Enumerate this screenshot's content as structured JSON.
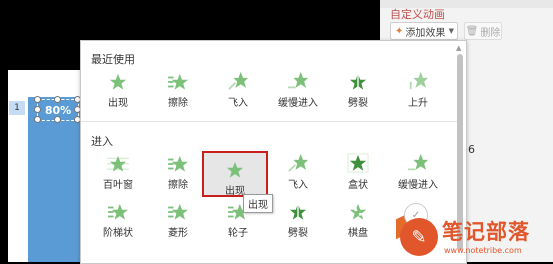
{
  "pane": {
    "title": "自定义动画",
    "add_label": "添加效果",
    "delete_label": "删除",
    "list_number": "6"
  },
  "slide": {
    "number": "1",
    "percent": "80%"
  },
  "popup": {
    "recent_title": "最近使用",
    "enter_title": "进入",
    "recent": [
      {
        "label": "出现",
        "icon": "star-appear-icon"
      },
      {
        "label": "擦除",
        "icon": "star-wipe-icon"
      },
      {
        "label": "飞入",
        "icon": "star-fly-in-icon"
      },
      {
        "label": "缓慢进入",
        "icon": "star-crawl-in-icon"
      },
      {
        "label": "劈裂",
        "icon": "star-split-icon"
      },
      {
        "label": "上升",
        "icon": "star-ascend-icon"
      }
    ],
    "enter_row1": [
      {
        "label": "百叶窗",
        "icon": "star-blinds-icon"
      },
      {
        "label": "擦除",
        "icon": "star-wipe-icon"
      },
      {
        "label": "出现",
        "icon": "star-appear-icon"
      },
      {
        "label": "飞入",
        "icon": "star-fly-in-icon"
      },
      {
        "label": "盒状",
        "icon": "star-box-icon"
      },
      {
        "label": "缓慢进入",
        "icon": "star-crawl-in-icon"
      }
    ],
    "enter_row2": [
      {
        "label": "阶梯状",
        "icon": "star-stairs-icon"
      },
      {
        "label": "菱形",
        "icon": "star-diamond-icon"
      },
      {
        "label": "轮子",
        "icon": "star-wheel-icon"
      },
      {
        "label": "劈裂",
        "icon": "star-split-icon"
      },
      {
        "label": "棋盘",
        "icon": "star-checkerboard-icon"
      }
    ],
    "tooltip": "出现"
  },
  "colors": {
    "star": "#7cc07a",
    "selection": "#c81e1e",
    "accent": "#c0504d",
    "watermark": "#e2562b"
  },
  "watermark": {
    "text": "笔记部落",
    "url": "www.notetribe.com"
  }
}
